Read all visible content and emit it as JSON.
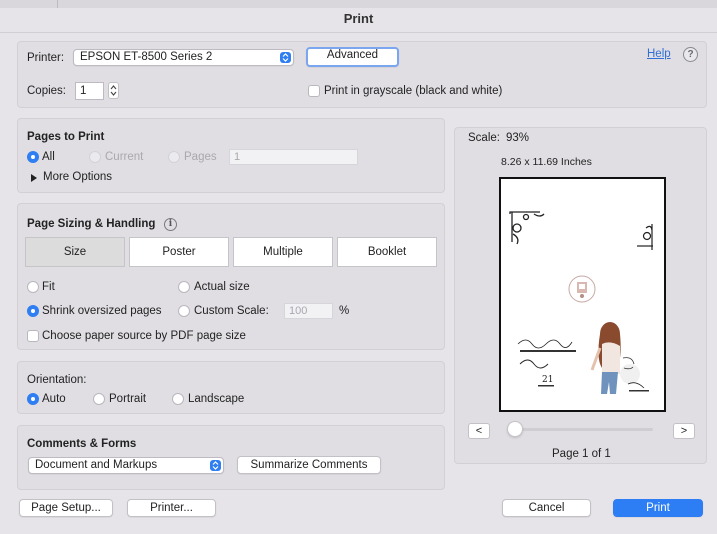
{
  "window": {
    "title": "Print"
  },
  "printer": {
    "label": "Printer:",
    "value": "EPSON ET-8500 Series 2",
    "advanced_label": "Advanced",
    "help_label": "Help",
    "help_icon": "?",
    "copies_label": "Copies:",
    "copies_value": "1",
    "grayscale_label": "Print in grayscale (black and white)"
  },
  "pages": {
    "heading": "Pages to Print",
    "all_label": "All",
    "current_label": "Current",
    "pages_label": "Pages",
    "pages_value": "1",
    "more_options_label": "More Options"
  },
  "sizing": {
    "heading": "Page Sizing & Handling",
    "info_icon": "i",
    "tabs": [
      "Size",
      "Poster",
      "Multiple",
      "Booklet"
    ],
    "selected_tab": "Size",
    "fit_label": "Fit",
    "actual_size_label": "Actual size",
    "shrink_label": "Shrink oversized pages",
    "custom_scale_label": "Custom Scale:",
    "custom_scale_value": "100",
    "percent_label": "%",
    "paper_source_label": "Choose paper source by PDF page size"
  },
  "orientation": {
    "heading": "Orientation:",
    "auto_label": "Auto",
    "portrait_label": "Portrait",
    "landscape_label": "Landscape"
  },
  "comments": {
    "heading": "Comments & Forms",
    "value": "Document and Markups",
    "summarize_label": "Summarize Comments"
  },
  "preview": {
    "scale_label": "Scale:",
    "scale_value": "93%",
    "dimensions": "8.26 x 11.69 Inches",
    "card_lines": [
      "Happy Birthday",
      "Abbie",
      "21",
      "Always & Happy"
    ],
    "prev_label": "<",
    "next_label": ">",
    "page_status": "Page 1 of 1"
  },
  "footer": {
    "page_setup_label": "Page Setup...",
    "printer_label": "Printer...",
    "cancel_label": "Cancel",
    "print_label": "Print"
  },
  "colors": {
    "accent": "#2f7ff2",
    "background": "#e6e4e8",
    "link": "#2f6fd6"
  }
}
